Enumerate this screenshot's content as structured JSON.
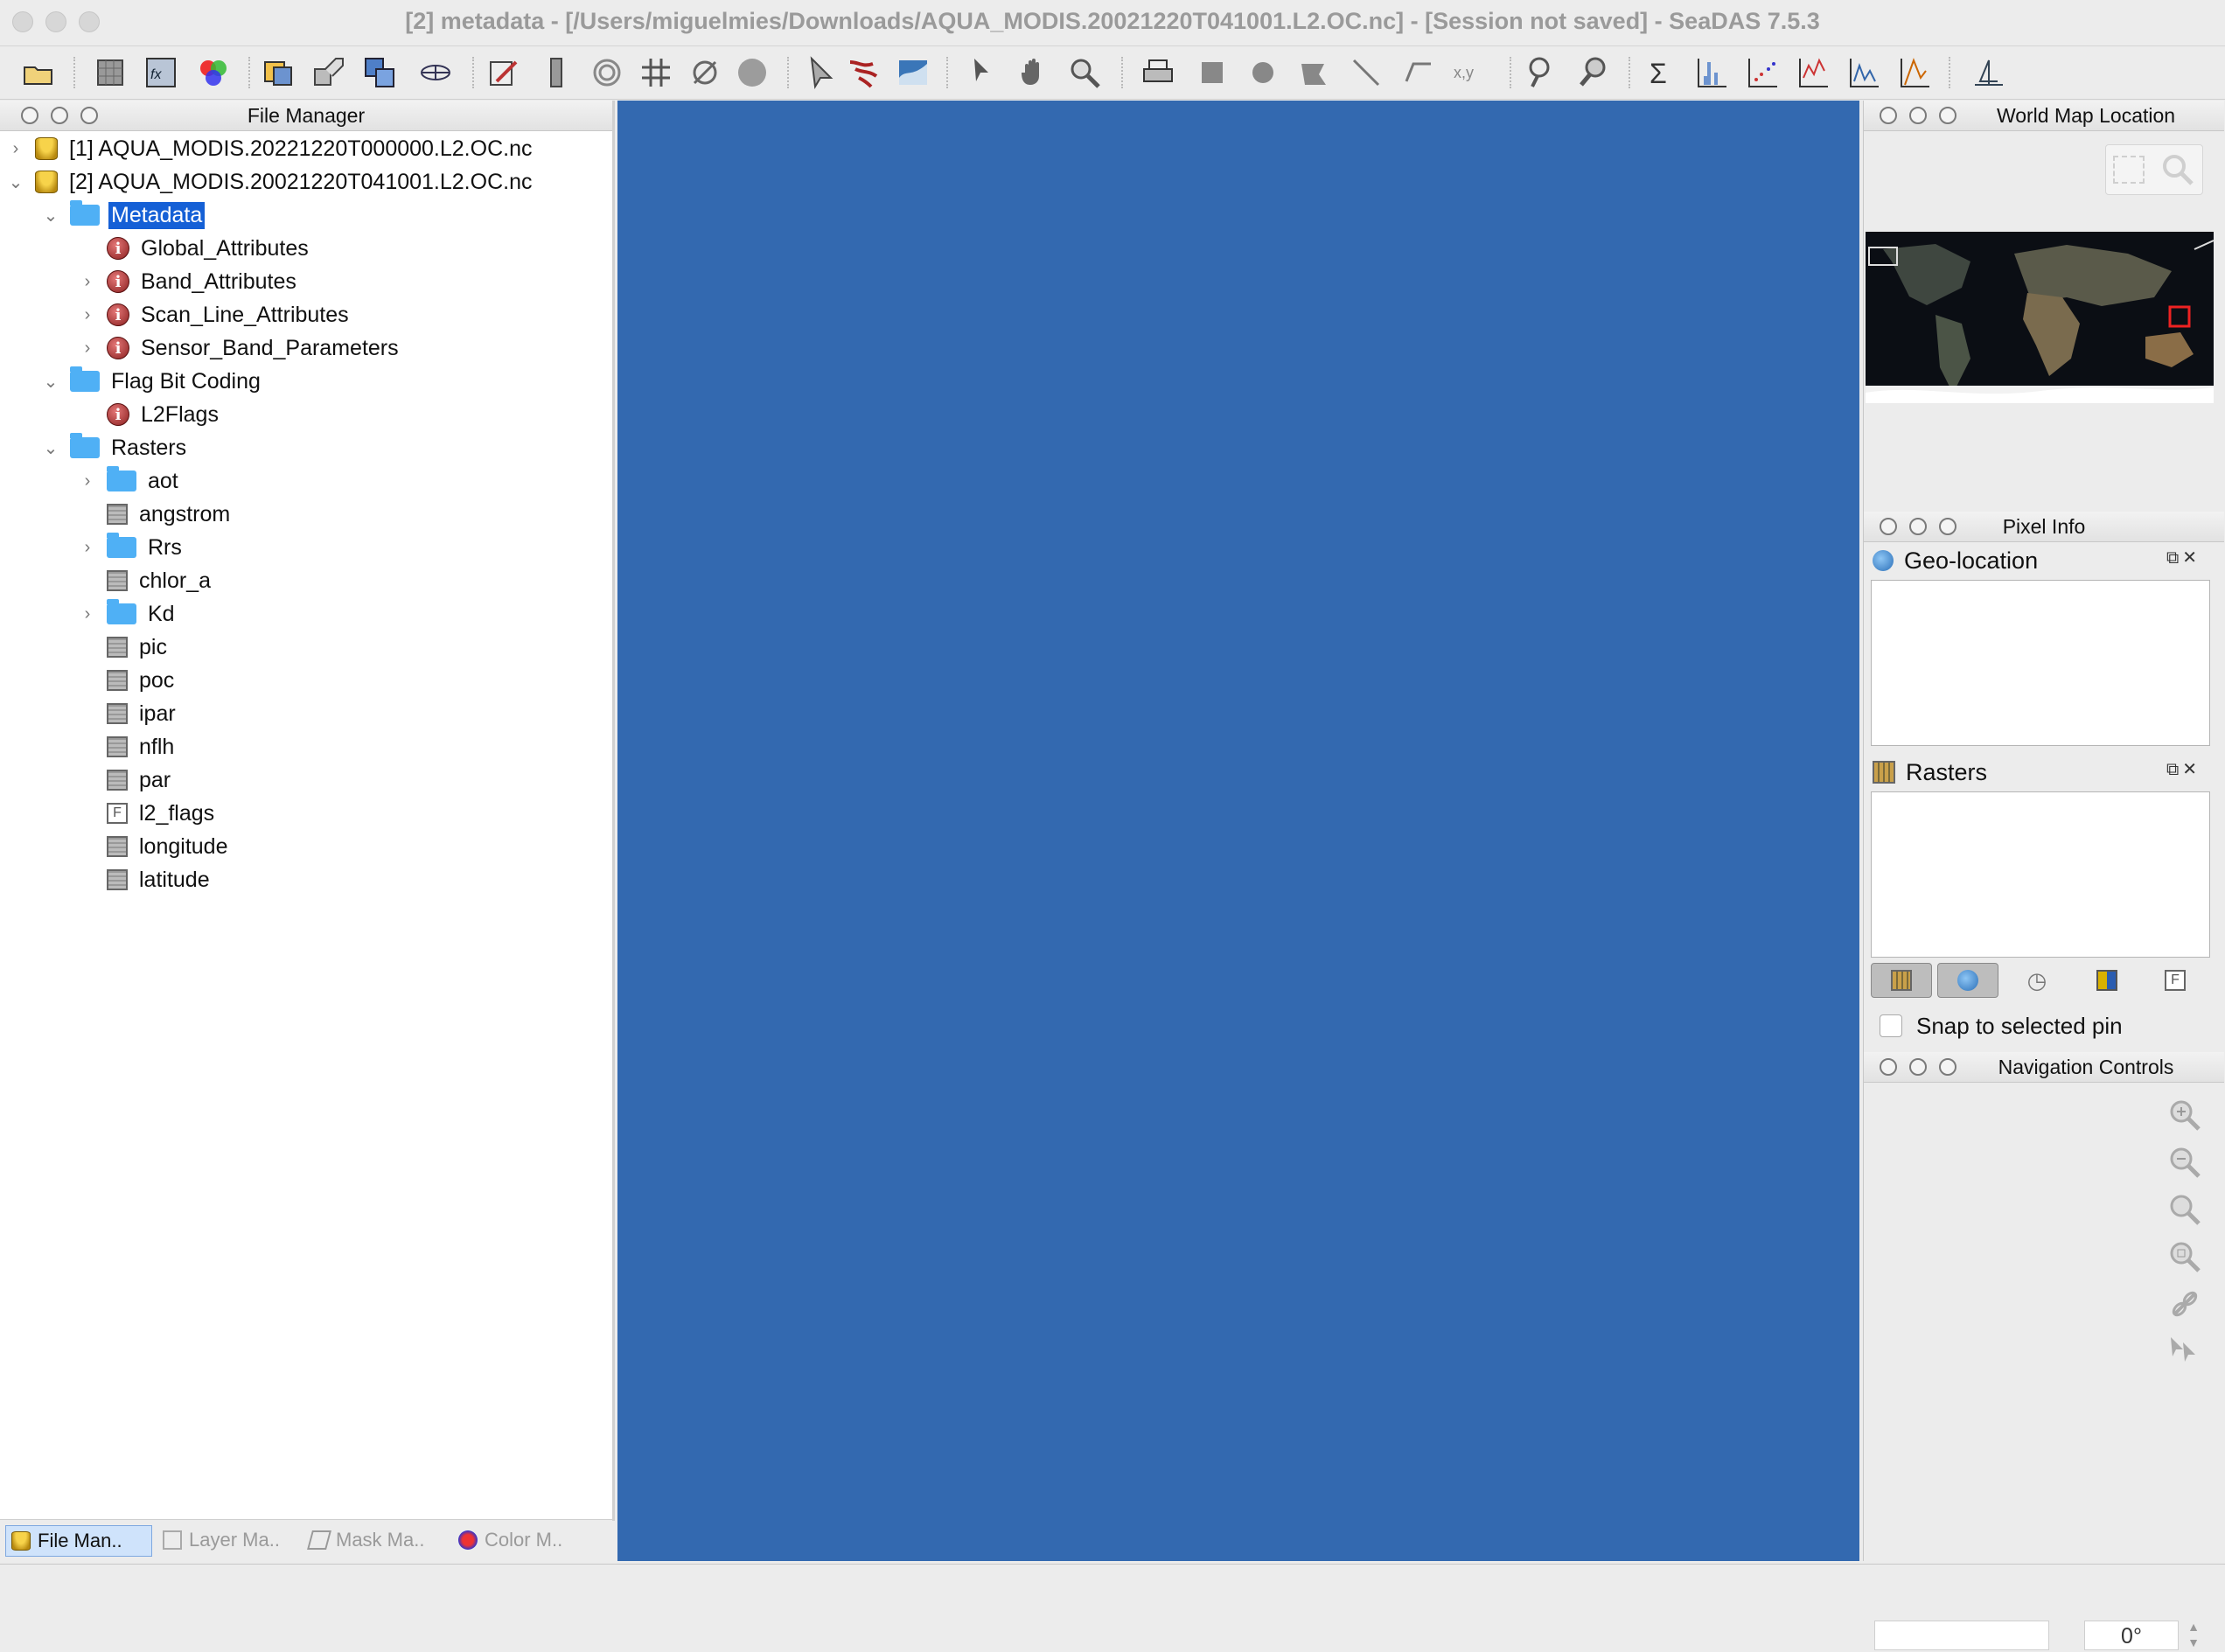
{
  "window": {
    "title": "[2] metadata - [/Users/miguelmies/Downloads/AQUA_MODIS.20021220T041001.L2.OC.nc] - [Session not saved] - SeaDAS 7.5.3"
  },
  "toolbar": {
    "icons": [
      "open-product",
      "band-maths",
      "fx-icon",
      "rgb-image",
      "reprojection",
      "subset",
      "mosaic",
      "geo-coding",
      "annotate",
      "ruler",
      "pins",
      "graticule",
      "no-data",
      "world",
      "pointer",
      "brush",
      "histogram-equalize",
      "select",
      "pan",
      "zoom",
      "print",
      "rectangle",
      "ellipse",
      "polygon",
      "line",
      "polyline",
      "xy-coordinates",
      "zoom-tool",
      "magnifier",
      "statistics",
      "histogram",
      "scatter-plot",
      "profile-plot",
      "spectrum",
      "information",
      "time-series"
    ]
  },
  "file_manager": {
    "title": "File Manager",
    "products": [
      {
        "label": "[1] AQUA_MODIS.20221220T000000.L2.OC.nc"
      },
      {
        "label": "[2] AQUA_MODIS.20021220T041001.L2.OC.nc"
      }
    ],
    "metadata_folder": "Metadata",
    "metadata_items": [
      "Global_Attributes",
      "Band_Attributes",
      "Scan_Line_Attributes",
      "Sensor_Band_Parameters"
    ],
    "flag_folder": "Flag Bit Coding",
    "flag_items": [
      "L2Flags"
    ],
    "rasters_folder": "Rasters",
    "raster_items": [
      "aot",
      "angstrom",
      "Rrs",
      "chlor_a",
      "Kd",
      "pic",
      "poc",
      "ipar",
      "nflh",
      "par",
      "l2_flags",
      "longitude",
      "latitude"
    ],
    "tabs": [
      "File Man..",
      "Layer Ma..",
      "Mask Ma..",
      "Color M.."
    ]
  },
  "world_map": {
    "title": "World Map Location"
  },
  "pixel_info": {
    "title": "Pixel Info",
    "geo_location": "Geo-location",
    "rasters": "Rasters",
    "snap_label": "Snap to selected pin",
    "snap_checked": false
  },
  "navigation": {
    "title": "Navigation Controls",
    "rotation": "0°",
    "zoom_value": ""
  },
  "colors": {
    "main_view": "#3369b0",
    "selection": "#1560d6"
  }
}
